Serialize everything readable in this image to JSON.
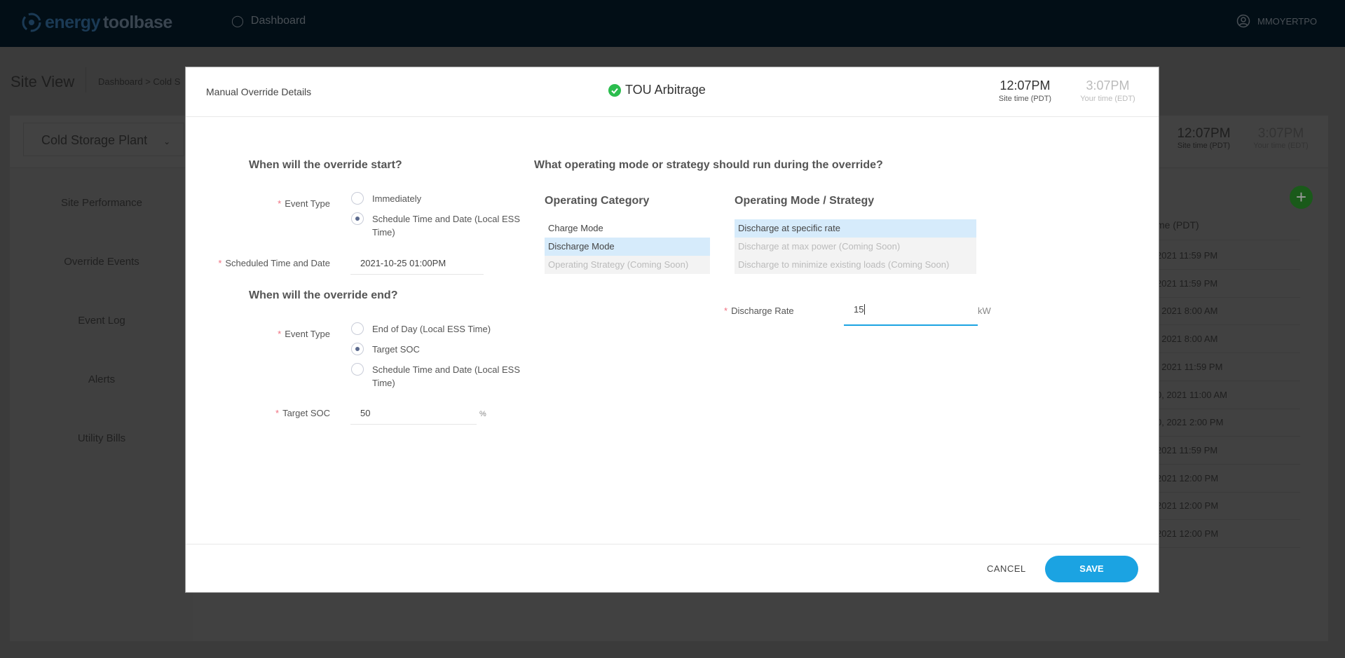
{
  "topbar": {
    "logo": {
      "part1": "energy",
      "part2": "toolbase"
    },
    "nav_dashboard": "Dashboard",
    "username": "MMOYERTPO"
  },
  "background": {
    "page_title": "Site View",
    "breadcrumb": "Dashboard > Cold S",
    "site_select": "Cold Storage Plant",
    "site_time": "12:07PM",
    "site_time_label": "Site time (PDT)",
    "your_time": "3:07PM",
    "your_time_label": "Your time (EDT)",
    "sidebar": [
      {
        "label": "Site Performance"
      },
      {
        "label": "Override Events"
      },
      {
        "label": "Event Log"
      },
      {
        "label": "Alerts"
      },
      {
        "label": "Utility Bills"
      }
    ],
    "table_header": "me (PDT)",
    "rows": [
      "2021 11:59 PM",
      "2021 11:59 PM",
      ", 2021 8:00 AM",
      ", 2021 8:00 AM",
      ", 2021 11:59 PM",
      "0, 2021 11:00 AM",
      "0, 2021 2:00 PM",
      "2021 11:59 PM",
      "2021 12:00 PM",
      "2021 12:00 PM",
      "2021 12:00 PM"
    ],
    "accent_add": "#1a7a1a"
  },
  "modal": {
    "title": "Manual Override Details",
    "strategy": "TOU Arbitrage",
    "site_time": "12:07PM",
    "site_time_label": "Site time (PDT)",
    "your_time": "3:07PM",
    "your_time_label": "Your time (EDT)",
    "start": {
      "heading": "When will the override start?",
      "event_type_label": "Event Type",
      "options": [
        {
          "label": "Immediately",
          "selected": false
        },
        {
          "label": "Schedule Time and Date (Local ESS Time)",
          "selected": true
        }
      ],
      "scheduled_label": "Scheduled Time and Date",
      "scheduled_value": "2021-10-25 01:00PM"
    },
    "end": {
      "heading": "When will the override end?",
      "event_type_label": "Event Type",
      "options": [
        {
          "label": "End of Day (Local ESS Time)",
          "selected": false
        },
        {
          "label": "Target SOC",
          "selected": true
        },
        {
          "label": "Schedule Time and Date (Local ESS Time)",
          "selected": false
        }
      ],
      "target_soc_label": "Target SOC",
      "target_soc_value": "50",
      "target_soc_unit": "%"
    },
    "mode": {
      "heading": "What operating mode or strategy should run during the override?",
      "category_heading": "Operating Category",
      "categories": [
        {
          "label": "Charge Mode",
          "state": "normal"
        },
        {
          "label": "Discharge Mode",
          "state": "selected"
        },
        {
          "label": "Operating Strategy (Coming Soon)",
          "state": "disabled"
        }
      ],
      "strategy_heading": "Operating Mode / Strategy",
      "strategies": [
        {
          "label": "Discharge at specific rate",
          "state": "selected"
        },
        {
          "label": "Discharge at max power (Coming Soon)",
          "state": "disabled"
        },
        {
          "label": "Discharge to minimize existing loads (Coming Soon)",
          "state": "disabled"
        }
      ],
      "rate_label": "Discharge Rate",
      "rate_value": "15",
      "rate_unit": "kW"
    },
    "cancel": "CANCEL",
    "save": "SAVE",
    "save_color": "#1ba3e2",
    "check_color": "#2bbd4e"
  }
}
